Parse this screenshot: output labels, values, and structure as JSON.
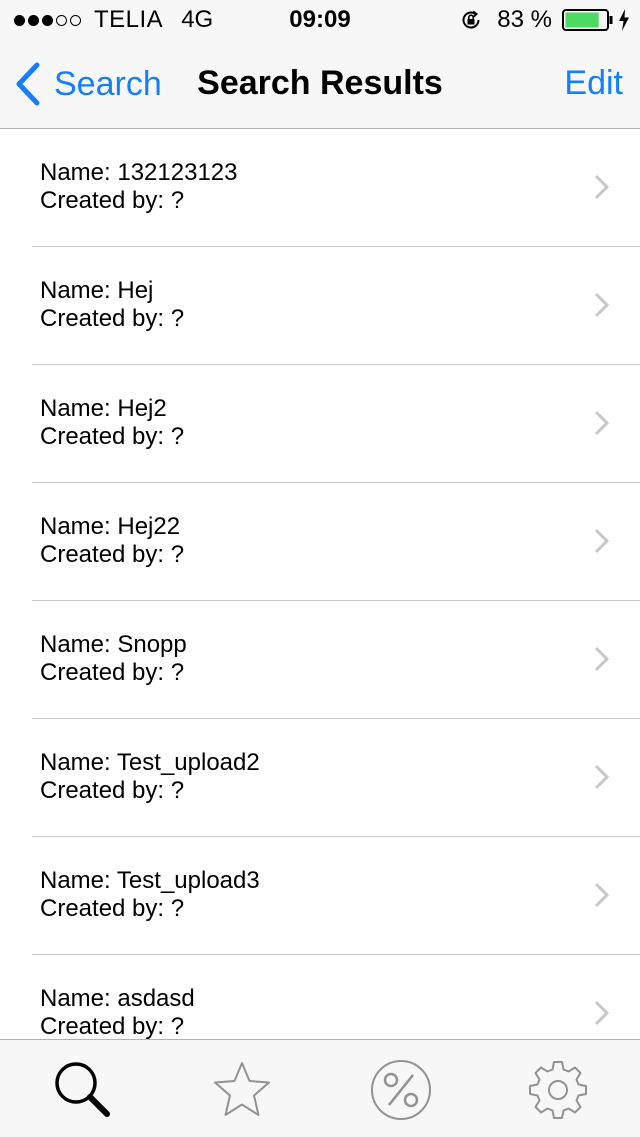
{
  "status_bar": {
    "carrier": "TELIA",
    "network": "4G",
    "time": "09:09",
    "battery_percent": "83 %",
    "battery_level": 0.83,
    "signal_bars_filled": 3,
    "signal_bars_total": 5
  },
  "nav": {
    "back_label": "Search",
    "title": "Search Results",
    "edit_label": "Edit"
  },
  "results": [
    {
      "name": "Name: 132123123",
      "created": "Created by: ?"
    },
    {
      "name": "Name: Hej",
      "created": "Created by: ?"
    },
    {
      "name": "Name: Hej2",
      "created": "Created by: ?"
    },
    {
      "name": "Name: Hej22",
      "created": "Created by: ?"
    },
    {
      "name": "Name: Snopp",
      "created": "Created by: ?"
    },
    {
      "name": "Name: Test_upload2",
      "created": "Created by: ?"
    },
    {
      "name": "Name: Test_upload3",
      "created": "Created by: ?"
    },
    {
      "name": "Name: asdasd",
      "created": "Created by: ?"
    }
  ],
  "tab_bar": {
    "tabs": [
      {
        "icon": "search-icon",
        "active": true
      },
      {
        "icon": "star-icon",
        "active": false
      },
      {
        "icon": "percent-icon",
        "active": false
      },
      {
        "icon": "gear-icon",
        "active": false
      }
    ]
  },
  "colors": {
    "accent": "#157efb",
    "battery": "#4cd964",
    "separator": "#c8c7cc",
    "inactive_icon": "#929292"
  }
}
